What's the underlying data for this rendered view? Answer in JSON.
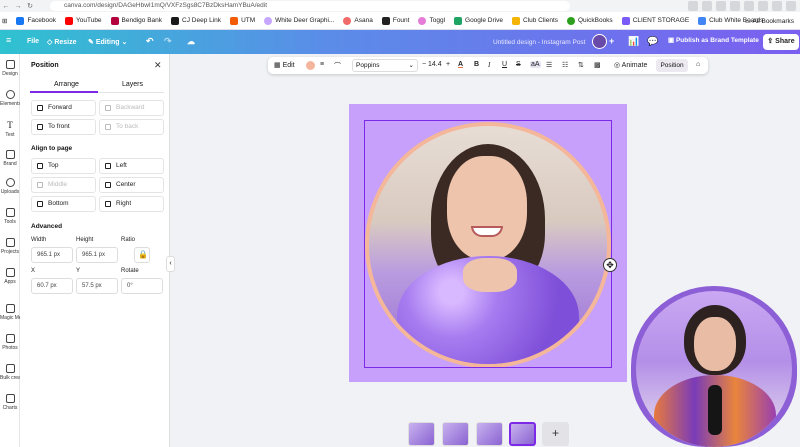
{
  "browser": {
    "url": "canva.com/design/DAGeHbwI1mQ/VXFzSgs8C7BzDksHamYBuA/edit",
    "bookmarks": [
      {
        "label": "Facebook",
        "color": "#1877f2"
      },
      {
        "label": "YouTube",
        "color": "#ff0000"
      },
      {
        "label": "Bendigo Bank",
        "color": "#b3003c"
      },
      {
        "label": "CJ Deep Link",
        "color": "#1a1a1a"
      },
      {
        "label": "UTM",
        "color": "#f25c05"
      },
      {
        "label": "White Deer Graphi...",
        "color": "#c7a6ff"
      },
      {
        "label": "Asana",
        "color": "#f06a6a"
      },
      {
        "label": "Fount",
        "color": "#222222"
      },
      {
        "label": "Toggl",
        "color": "#e57cd8"
      },
      {
        "label": "Google Drive",
        "color": "#1fa463"
      },
      {
        "label": "Club Clients",
        "color": "#f4b400"
      },
      {
        "label": "QuickBooks",
        "color": "#2ca01c"
      },
      {
        "label": "CLIENT STORAGE",
        "color": "#7a5af8"
      },
      {
        "label": "Club White Boards",
        "color": "#4285f4"
      }
    ],
    "all_bookmarks": "All Bookmarks"
  },
  "header": {
    "file": "File",
    "resize": "Resize",
    "editing": "Editing",
    "title": "Untitled design - Instagram Post",
    "publish": "Publish as Brand Template",
    "share": "Share"
  },
  "rail": [
    {
      "label": "Design"
    },
    {
      "label": "Elements"
    },
    {
      "label": "Text"
    },
    {
      "label": "Brand"
    },
    {
      "label": "Uploads"
    },
    {
      "label": "Tools"
    },
    {
      "label": "Projects"
    },
    {
      "label": "Apps"
    },
    {
      "label": "Magic Media"
    },
    {
      "label": "Photos"
    },
    {
      "label": "Bulk create"
    },
    {
      "label": "Charts"
    }
  ],
  "panel": {
    "title": "Position",
    "tabs": [
      "Arrange",
      "Layers"
    ],
    "arrange": {
      "forward": "Forward",
      "backward": "Backward",
      "to_front": "To front",
      "to_back": "To back"
    },
    "align_title": "Align to page",
    "align": {
      "top": "Top",
      "left": "Left",
      "middle": "Middle",
      "center": "Center",
      "bottom": "Bottom",
      "right": "Right"
    },
    "advanced_title": "Advanced",
    "labels": {
      "width": "Width",
      "height": "Height",
      "ratio": "Ratio",
      "x": "X",
      "y": "Y",
      "rotate": "Rotate"
    },
    "values": {
      "width": "965.1 px",
      "height": "965.1 px",
      "x": "60.7 px",
      "y": "57.5 px",
      "rotate": "0°"
    }
  },
  "toolbar": {
    "edit": "Edit",
    "font": "Poppins",
    "font_size": "14.4",
    "bold": "B",
    "italic": "I",
    "underline": "U",
    "strike": "S",
    "case": "aA",
    "animate": "Animate",
    "position": "Position",
    "text_color": "#f5b59c"
  },
  "pages": {
    "add": "+"
  },
  "colors": {
    "accent": "#7d2ae8",
    "canvas_bg": "#c6a0fa",
    "ring": "#f5b79a"
  }
}
